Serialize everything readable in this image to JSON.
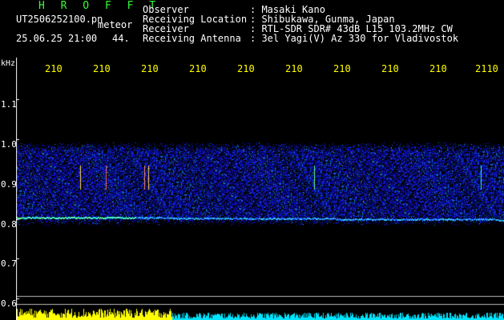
{
  "header": {
    "title": "H R O F F T",
    "filename": "UT2506252100.pn",
    "meteor_label": "meteor",
    "datetime": "25.06.25 21:00",
    "count": "44.",
    "rows": [
      {
        "label": "Observer",
        "value": ": Masaki Kano"
      },
      {
        "label": "Receiving Location",
        "value": ": Shibukawa, Gunma, Japan"
      },
      {
        "label": "Receiver",
        "value": ": RTL-SDR SDR# 43dB L15 103.2MHz CW"
      },
      {
        "label": "Receiving Antenna",
        "value": ": 3el Yagi(V) Az 330 for Vladivostok"
      }
    ]
  },
  "axis": {
    "y_unit": "kHz",
    "y_ticks": [
      "1.1",
      "1.0",
      "0.9",
      "0.8",
      "0.7",
      "0.6"
    ],
    "x_ticks": [
      "210",
      "210",
      "210",
      "210",
      "210",
      "210",
      "210",
      "210",
      "210",
      "2110"
    ]
  },
  "colors": {
    "background": "#000000",
    "title": "#33ff33",
    "time_ticks": "#ffff00",
    "noise": "#1a3cff",
    "echo_line": "#33ffdd",
    "histogram_meteor": "#ffff00",
    "histogram_noise": "#00e5ff"
  }
}
